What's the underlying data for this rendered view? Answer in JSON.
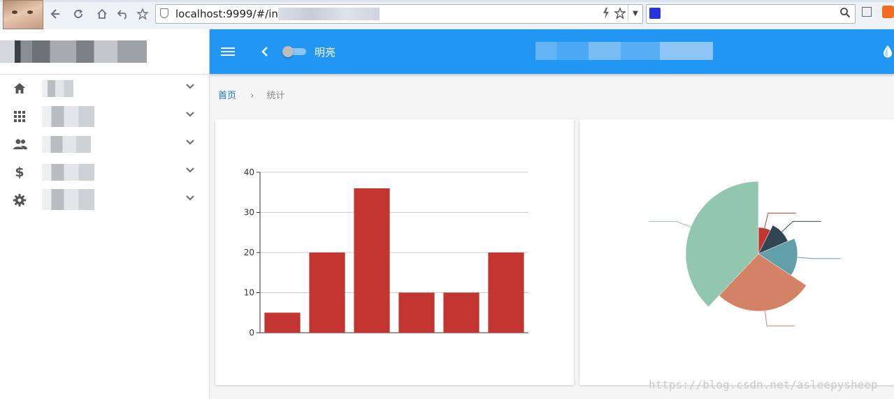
{
  "browser": {
    "url": "localhost:9999/#/inde",
    "icons": [
      "back-icon",
      "reload-icon",
      "home-icon",
      "undo-icon",
      "star-icon"
    ]
  },
  "sidebar": {
    "title": "",
    "items": [
      {
        "icon": "home-icon",
        "label": ""
      },
      {
        "icon": "apps-icon",
        "label": ""
      },
      {
        "icon": "people-icon",
        "label": ""
      },
      {
        "icon": "dollar-icon",
        "label": ""
      },
      {
        "icon": "gear-icon",
        "label": ""
      }
    ]
  },
  "appbar": {
    "theme_label": "明亮",
    "title": ""
  },
  "breadcrumb": {
    "home": "首页",
    "separator": "›",
    "current": "统计"
  },
  "colors": {
    "appbar": "#2196f3",
    "bar": "#c23531",
    "pie": [
      "#c23531",
      "#2f4554",
      "#61a0a8",
      "#d48265",
      "#91c7ae"
    ]
  },
  "chart_data": [
    {
      "type": "bar",
      "categories": [
        "",
        "",
        "",
        "",
        "",
        ""
      ],
      "values": [
        5,
        20,
        36,
        10,
        10,
        20
      ],
      "ylim": [
        0,
        40
      ],
      "yticks": [
        "0",
        "10",
        "20",
        "30",
        "40"
      ],
      "grid": true
    },
    {
      "type": "pie",
      "labels": [
        "",
        "",
        "",
        "",
        ""
      ],
      "values": [
        8,
        12,
        17,
        30,
        41
      ],
      "rose_type": "radius"
    }
  ],
  "watermark": "https://blog.csdn.net/asleepysheep"
}
